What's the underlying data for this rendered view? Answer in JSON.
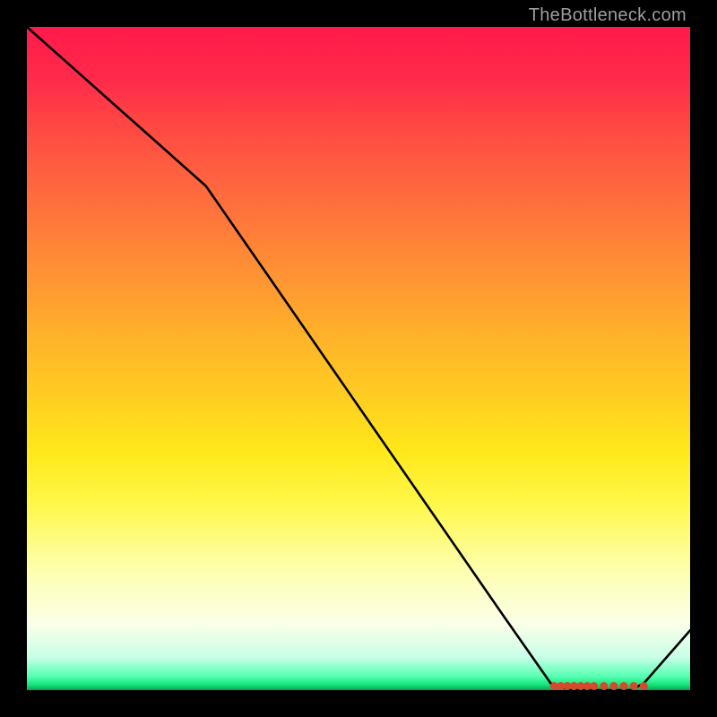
{
  "watermark": "TheBottleneck.com",
  "chart_data": {
    "type": "line",
    "title": "",
    "xlabel": "",
    "ylabel": "",
    "xlim": [
      0,
      100
    ],
    "ylim": [
      0,
      100
    ],
    "series": [
      {
        "name": "curve",
        "x": [
          0,
          9,
          18,
          27,
          36,
          45,
          54,
          63,
          72,
          79,
          82,
          85,
          88,
          91,
          93,
          100
        ],
        "values": [
          100,
          92,
          84,
          76,
          63,
          50,
          37,
          24,
          11,
          1,
          0,
          0,
          0,
          0,
          1,
          9
        ],
        "color": "#000000"
      }
    ],
    "markers": {
      "name": "flat-segment-points",
      "x": [
        79.5,
        80.5,
        81.5,
        82.5,
        83.5,
        84.5,
        85.5,
        87,
        88.5,
        90,
        91.5,
        93
      ],
      "values": [
        0.6,
        0.6,
        0.6,
        0.6,
        0.6,
        0.6,
        0.6,
        0.6,
        0.6,
        0.6,
        0.6,
        0.6
      ],
      "color": "#d44a2a",
      "size": 4.5
    },
    "gradient_stops": [
      {
        "pos": 0.0,
        "color": "#ff1a4b"
      },
      {
        "pos": 0.5,
        "color": "#ffbf26"
      },
      {
        "pos": 0.82,
        "color": "#fdffb0"
      },
      {
        "pos": 1.0,
        "color": "#0aa157"
      }
    ]
  }
}
